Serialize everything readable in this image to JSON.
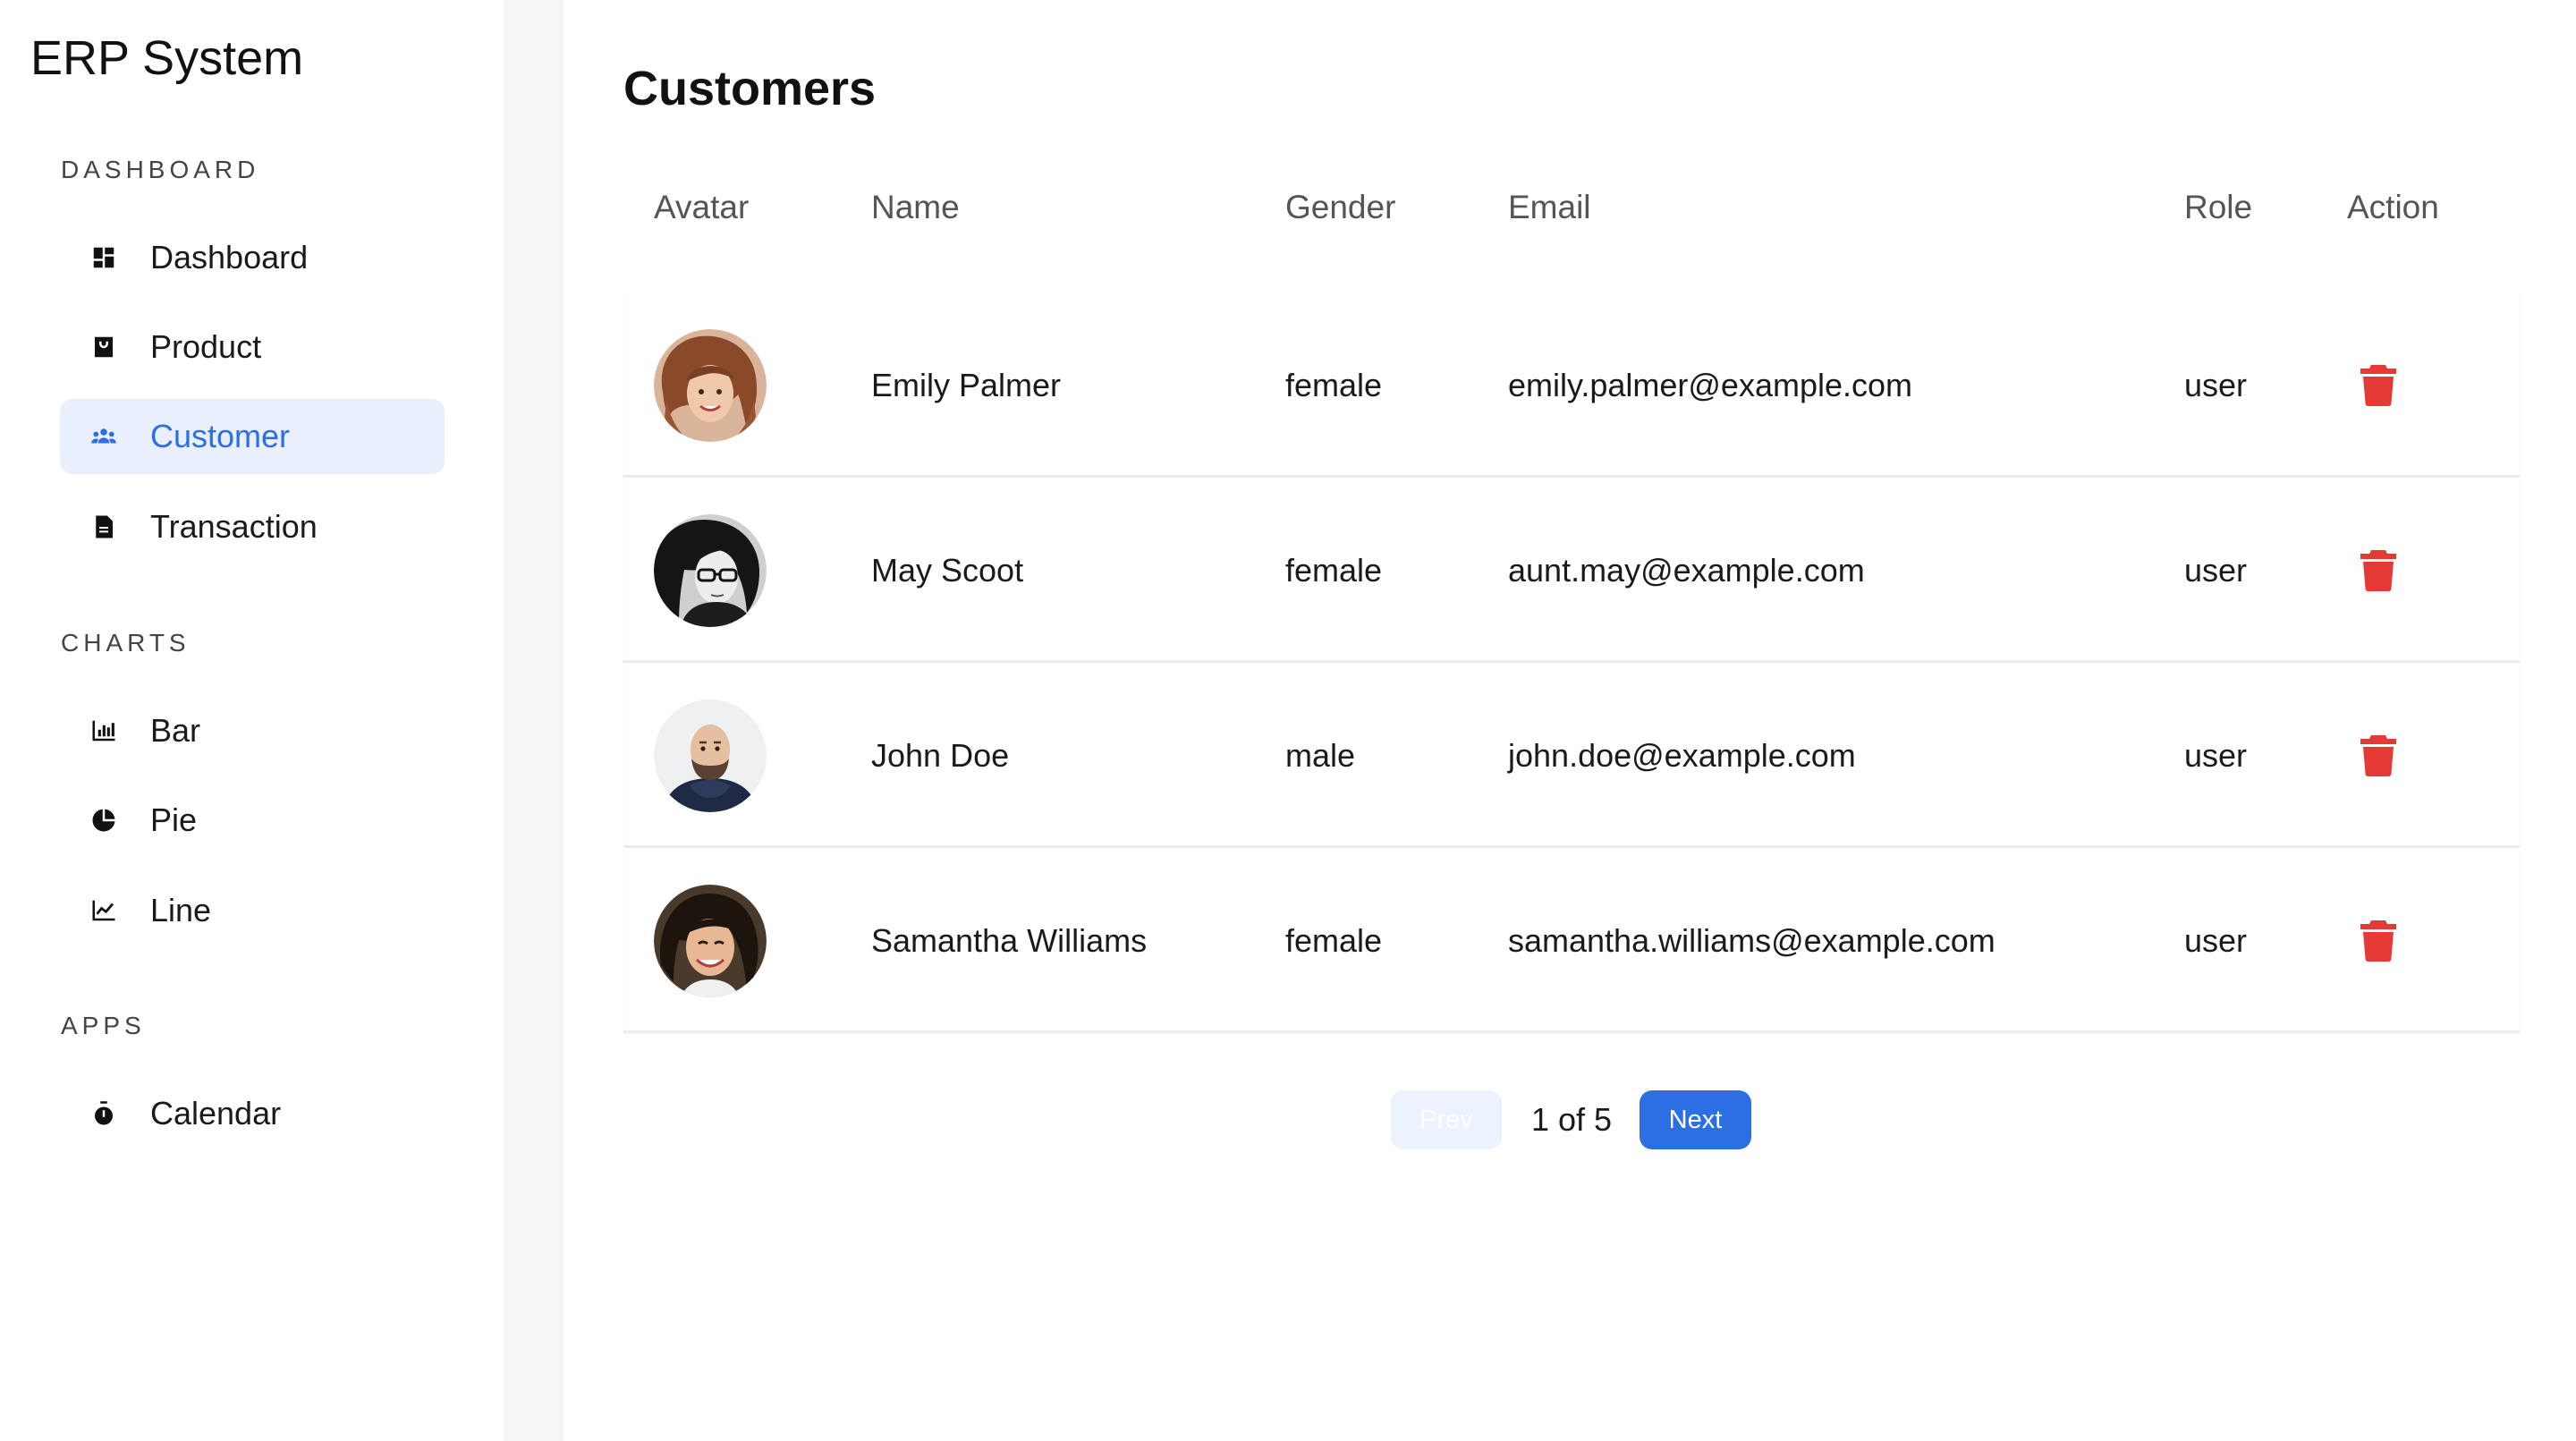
{
  "app": {
    "title": "ERP System"
  },
  "sidebar": {
    "sections": [
      {
        "title": "DASHBOARD",
        "items": [
          {
            "label": "Dashboard",
            "icon": "dashboard-icon",
            "active": false
          },
          {
            "label": "Product",
            "icon": "shopping-bag-icon",
            "active": false
          },
          {
            "label": "Customer",
            "icon": "people-icon",
            "active": true
          },
          {
            "label": "Transaction",
            "icon": "document-icon",
            "active": false
          }
        ]
      },
      {
        "title": "CHARTS",
        "items": [
          {
            "label": "Bar",
            "icon": "bar-chart-icon",
            "active": false
          },
          {
            "label": "Pie",
            "icon": "pie-chart-icon",
            "active": false
          },
          {
            "label": "Line",
            "icon": "line-chart-icon",
            "active": false
          }
        ]
      },
      {
        "title": "APPS",
        "items": [
          {
            "label": "Calendar",
            "icon": "stopwatch-icon",
            "active": false
          }
        ]
      }
    ]
  },
  "main": {
    "title": "Customers",
    "columns": [
      "Avatar",
      "Name",
      "Gender",
      "Email",
      "Role",
      "Action"
    ],
    "rows": [
      {
        "name": "Emily Palmer",
        "gender": "female",
        "email": "emily.palmer@example.com",
        "role": "user",
        "avatar": "avatar-woman-curly-hair"
      },
      {
        "name": "May Scoot",
        "gender": "female",
        "email": "aunt.may@example.com",
        "role": "user",
        "avatar": "avatar-woman-glasses"
      },
      {
        "name": "John Doe",
        "gender": "male",
        "email": "john.doe@example.com",
        "role": "user",
        "avatar": "avatar-bald-man"
      },
      {
        "name": "Samantha Williams",
        "gender": "female",
        "email": "samantha.williams@example.com",
        "role": "user",
        "avatar": "avatar-woman-smiling"
      }
    ],
    "action_icon": "trash-icon"
  },
  "pagination": {
    "prev_label": "Prev",
    "page_info": "1 of 5",
    "next_label": "Next"
  },
  "colors": {
    "accent": "#2c6fe3",
    "active_bg": "#e9effd",
    "danger": "#e53935",
    "strip": "#f6f6f6"
  }
}
